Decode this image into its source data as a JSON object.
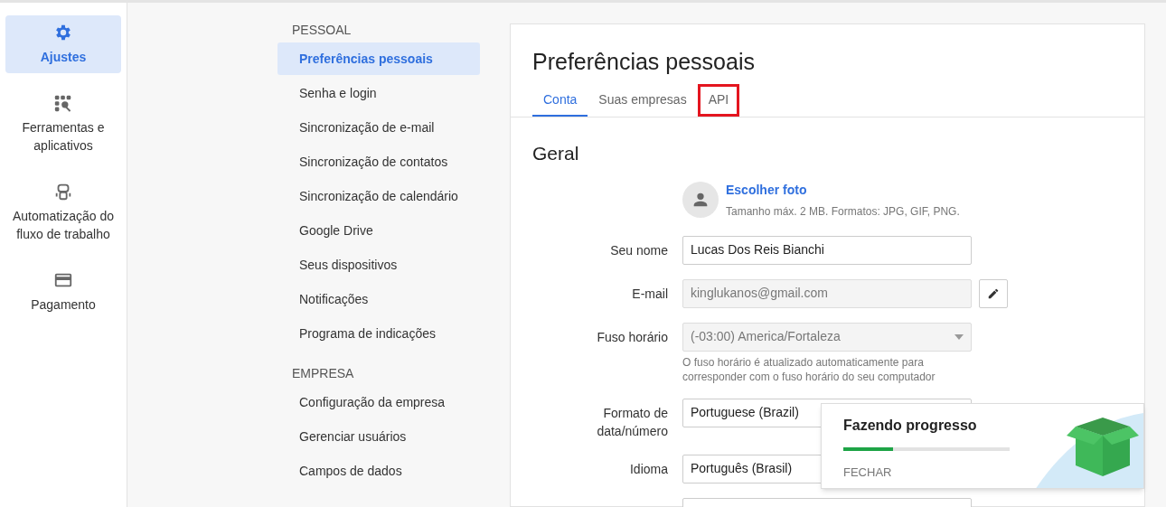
{
  "nav": [
    {
      "label": "Ajustes",
      "kind": "gear",
      "selected": true
    },
    {
      "label": "Ferramentas e aplicativos",
      "kind": "tools",
      "selected": false
    },
    {
      "label": "Automatização do fluxo de trabalho",
      "kind": "robot",
      "selected": false
    },
    {
      "label": "Pagamento",
      "kind": "card",
      "selected": false
    }
  ],
  "menu": [
    {
      "heading": "PESSOAL",
      "items": [
        {
          "label": "Preferências pessoais",
          "selected": true
        },
        {
          "label": "Senha e login",
          "selected": false
        },
        {
          "label": "Sincronização de e-mail",
          "selected": false
        },
        {
          "label": "Sincronização de contatos",
          "selected": false
        },
        {
          "label": "Sincronização de calendário",
          "selected": false
        },
        {
          "label": "Google Drive",
          "selected": false
        },
        {
          "label": "Seus dispositivos",
          "selected": false
        },
        {
          "label": "Notificações",
          "selected": false
        },
        {
          "label": "Programa de indicações",
          "selected": false
        }
      ]
    },
    {
      "heading": "EMPRESA",
      "items": [
        {
          "label": "Configuração da empresa",
          "selected": false
        },
        {
          "label": "Gerenciar usuários",
          "selected": false
        },
        {
          "label": "Campos de dados",
          "selected": false
        }
      ]
    }
  ],
  "page": {
    "title": "Preferências pessoais",
    "tabs": [
      {
        "label": "Conta",
        "selected": true,
        "highlighted": false
      },
      {
        "label": "Suas empresas",
        "selected": false,
        "highlighted": false
      },
      {
        "label": "API",
        "selected": false,
        "highlighted": true
      }
    ],
    "section": "Geral",
    "photo": {
      "link": "Escolher foto",
      "hint": "Tamanho máx. 2 MB. Formatos: JPG, GIF, PNG."
    },
    "fields": [
      {
        "label": "Seu nome",
        "value": "Lucas Dos Reis Bianchi",
        "kind": "text",
        "disabled": false
      },
      {
        "label": "E-mail",
        "value": "kinglukanos@gmail.com",
        "kind": "text",
        "disabled": true,
        "editable": true
      },
      {
        "label": "Fuso horário",
        "value": "(-03:00) America/Fortaleza",
        "kind": "select",
        "disabled": true,
        "help": "O fuso horário é atualizado automaticamente para corresponder com o fuso horário do seu computador"
      },
      {
        "label": "Formato de data/número",
        "value": "Portuguese (Brazil)",
        "kind": "select",
        "disabled": false
      },
      {
        "label": "Idioma",
        "value": "Português (Brasil)",
        "kind": "select",
        "disabled": false
      }
    ]
  },
  "toast": {
    "title": "Fazendo progresso",
    "level": 0.3,
    "action": "FECHAR"
  }
}
